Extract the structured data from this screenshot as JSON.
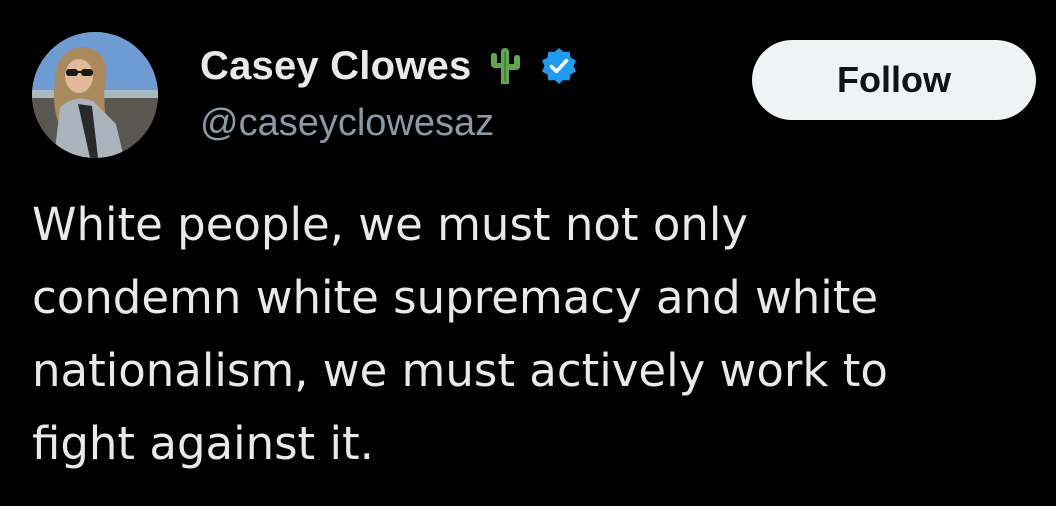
{
  "author": {
    "display_name": "Casey Clowes",
    "handle": "@caseyclowesaz",
    "name_emoji": "cactus-icon",
    "badge": "verified-badge-icon",
    "badge_color": "#1d9bf0"
  },
  "follow_button": {
    "label": "Follow"
  },
  "tweet": {
    "lines": [
      "White people, we must not only",
      "condemn white supremacy and white",
      "nationalism, we must actively work to",
      "fight against it."
    ]
  },
  "colors": {
    "background": "#000000",
    "text_primary": "#e7e9ea",
    "text_secondary": "#8b98a5",
    "button_bg": "#eff3f4",
    "button_text": "#0f1419"
  }
}
